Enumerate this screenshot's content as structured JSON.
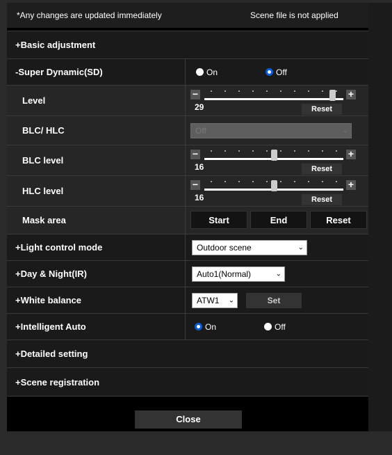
{
  "header": {
    "changes_notice": "*Any changes are updated immediately",
    "scene_status": "Scene file is not applied"
  },
  "sections": {
    "basic_adjustment": "+Basic adjustment",
    "super_dynamic": "-Super Dynamic(SD)",
    "light_control_mode": "+Light control mode",
    "day_night": "+Day & Night(IR)",
    "white_balance": "+White balance",
    "intelligent_auto": "+Intelligent Auto",
    "detailed_setting": "+Detailed setting",
    "scene_registration": "+Scene registration"
  },
  "super_dynamic": {
    "on_label": "On",
    "off_label": "Off",
    "selected": "Off"
  },
  "level": {
    "label": "Level",
    "value": "29",
    "fraction": 0.92,
    "reset": "Reset",
    "minus": "−",
    "plus": "+"
  },
  "blc_hlc": {
    "label": "BLC/ HLC",
    "value": "Off"
  },
  "blc_level": {
    "label": "BLC level",
    "value": "16",
    "fraction": 0.5,
    "reset": "Reset",
    "minus": "−",
    "plus": "+"
  },
  "hlc_level": {
    "label": "HLC level",
    "value": "16",
    "fraction": 0.5,
    "reset": "Reset",
    "minus": "−",
    "plus": "+"
  },
  "mask_area": {
    "label": "Mask area",
    "start": "Start",
    "end": "End",
    "reset": "Reset"
  },
  "light_control": {
    "value": "Outdoor scene"
  },
  "day_night": {
    "value": "Auto1(Normal)"
  },
  "white_balance": {
    "value": "ATW1",
    "set_label": "Set"
  },
  "intelligent_auto": {
    "on_label": "On",
    "off_label": "Off",
    "selected": "On"
  },
  "close_label": "Close",
  "colors": {
    "accent": "#0a5cd6",
    "panel": "#000000",
    "row": "#262626"
  }
}
